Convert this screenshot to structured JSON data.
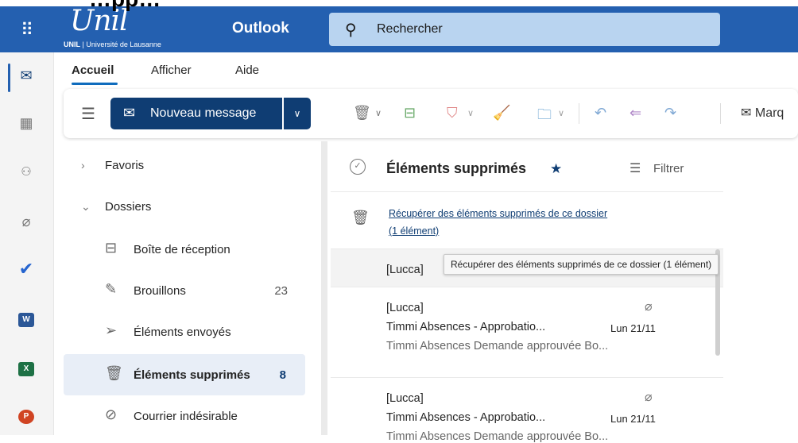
{
  "cut_heading": "…pp…",
  "header": {
    "logo_script": "Unil",
    "logo_sub_bold": "UNIL",
    "logo_sub": " | Université de Lausanne",
    "app_name": "Outlook",
    "search_placeholder": "Rechercher"
  },
  "rail": {
    "apps": [
      {
        "icon": "mail-icon",
        "glyph": "✉",
        "active": true
      },
      {
        "icon": "calendar-icon",
        "glyph": "▦"
      },
      {
        "icon": "people-icon",
        "glyph": "👥"
      },
      {
        "icon": "attachment-icon",
        "glyph": "📎"
      },
      {
        "icon": "todo-icon",
        "glyph": "✔"
      },
      {
        "icon": "word-icon",
        "glyph": "W",
        "color": "#2b5797"
      },
      {
        "icon": "excel-icon",
        "glyph": "X",
        "color": "#1e7145"
      },
      {
        "icon": "powerpoint-icon",
        "glyph": "P",
        "color": "#d04423"
      }
    ]
  },
  "ribbon": {
    "tabs": [
      "Accueil",
      "Afficher",
      "Aide"
    ],
    "new_message_label": "Nouveau message",
    "mark_label": "Marq"
  },
  "folders": {
    "favorites_label": "Favoris",
    "dossiers_label": "Dossiers",
    "items": [
      {
        "label": "Boîte de réception",
        "count": "",
        "icon": "inbox-icon",
        "glyph": "⊟"
      },
      {
        "label": "Brouillons",
        "count": "23",
        "icon": "drafts-icon",
        "glyph": "✎"
      },
      {
        "label": "Éléments envoyés",
        "count": "",
        "icon": "sent-icon",
        "glyph": "➢"
      },
      {
        "label": "Éléments supprimés",
        "count": "8",
        "icon": "trash-icon",
        "glyph": "🗑",
        "selected": true
      },
      {
        "label": "Courrier indésirable",
        "count": "",
        "icon": "junk-icon",
        "glyph": "⊘"
      }
    ]
  },
  "mail_list": {
    "title": "Éléments supprimés",
    "filter_label": "Filtrer",
    "recover_line1": "Récupérer des éléments supprimés de ce dossier",
    "recover_line2": "(1 élément)",
    "tooltip": "Récupérer des éléments supprimés de ce dossier (1 élément)",
    "messages": [
      {
        "sender": "[Lucca]",
        "subject": "",
        "date": "",
        "preview": ""
      },
      {
        "sender": "[Lucca]",
        "subject": "Timmi Absences - Approbatio...",
        "date": "Lun 21/11",
        "preview": "Timmi Absences Demande approuvée Bo..."
      },
      {
        "sender": "[Lucca]",
        "subject": "Timmi Absences - Approbatio...",
        "date": "Lun 21/11",
        "preview": "Timmi Absences Demande approuvée Bo..."
      }
    ]
  },
  "colors": {
    "brand_blue": "#2460b0",
    "primary_button": "#0f3d73",
    "search_bg": "#b9d4f0"
  }
}
